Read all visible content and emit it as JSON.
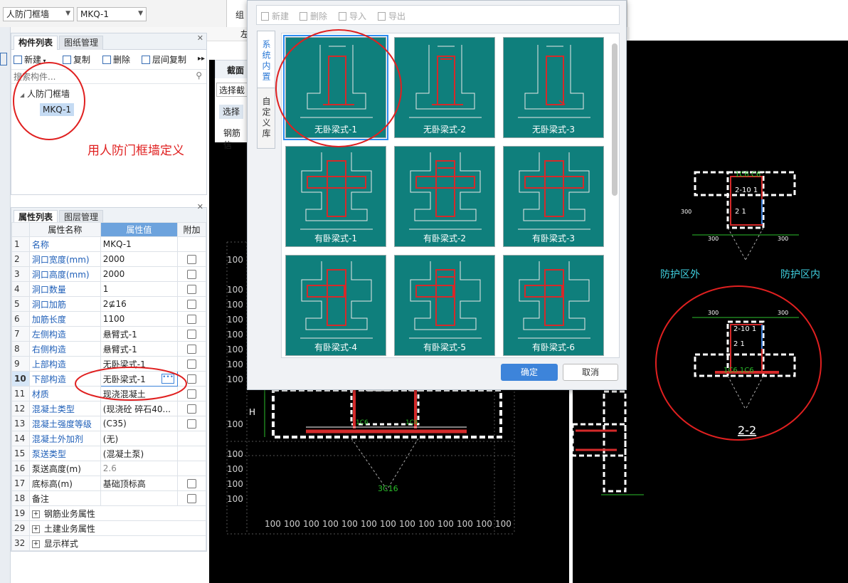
{
  "toolbar": {
    "type_combo": "人防门框墙",
    "item_combo": "MKQ-1",
    "title_fragment": "组",
    "left_fragment": "左"
  },
  "component_panel": {
    "tabs": [
      "构件列表",
      "图纸管理"
    ],
    "buttons": {
      "new": "新建",
      "copy": "复制",
      "delete": "删除",
      "floor_copy": "层间复制"
    },
    "search_placeholder": "搜索构件...",
    "tree_root": "人防门框墙",
    "tree_child": "MKQ-1",
    "annotation": "用人防门框墙定义"
  },
  "property_panel": {
    "tabs": [
      "属性列表",
      "图层管理"
    ],
    "headers": {
      "name": "属性名称",
      "value": "属性值",
      "extra": "附加"
    },
    "rows": [
      {
        "no": "1",
        "name": "名称",
        "value": "MKQ-1",
        "blue": true,
        "check": false
      },
      {
        "no": "2",
        "name": "洞口宽度(mm)",
        "value": "2000",
        "blue": true,
        "check": true
      },
      {
        "no": "3",
        "name": "洞口高度(mm)",
        "value": "2000",
        "blue": true,
        "check": true
      },
      {
        "no": "4",
        "name": "洞口数量",
        "value": "1",
        "blue": true,
        "check": true
      },
      {
        "no": "5",
        "name": "洞口加筋",
        "value": "2⊈16",
        "blue": true,
        "check": true
      },
      {
        "no": "6",
        "name": "加筋长度",
        "value": "1100",
        "blue": true,
        "check": true
      },
      {
        "no": "7",
        "name": "左侧构造",
        "value": "悬臂式-1",
        "blue": true,
        "check": true
      },
      {
        "no": "8",
        "name": "右侧构造",
        "value": "悬臂式-1",
        "blue": true,
        "check": true
      },
      {
        "no": "9",
        "name": "上部构造",
        "value": "无卧梁式-1",
        "blue": true,
        "check": true
      },
      {
        "no": "10",
        "name": "下部构造",
        "value": "无卧梁式-1",
        "blue": true,
        "check": true
      },
      {
        "no": "11",
        "name": "材质",
        "value": "现浇混凝土",
        "blue": true,
        "check": true
      },
      {
        "no": "12",
        "name": "混凝土类型",
        "value": "(现浇砼 碎石40...",
        "blue": true,
        "check": true
      },
      {
        "no": "13",
        "name": "混凝土强度等级",
        "value": "(C35)",
        "blue": true,
        "check": true
      },
      {
        "no": "14",
        "name": "混凝土外加剂",
        "value": "(无)",
        "blue": true,
        "check": false
      },
      {
        "no": "15",
        "name": "泵送类型",
        "value": "(混凝土泵)",
        "blue": true,
        "check": false
      },
      {
        "no": "16",
        "name": "泵送高度(m)",
        "value": "2.6",
        "blue": false,
        "gray": true,
        "check": false
      },
      {
        "no": "17",
        "name": "底标高(m)",
        "value": "基础顶标高",
        "blue": false,
        "check": true
      },
      {
        "no": "18",
        "name": "备注",
        "value": "",
        "blue": false,
        "check": true
      }
    ],
    "groups": [
      {
        "no": "19",
        "name": "钢筋业务属性"
      },
      {
        "no": "29",
        "name": "土建业务属性"
      },
      {
        "no": "32",
        "name": "显示样式"
      }
    ]
  },
  "section_panel": {
    "title": "截面",
    "select_combo": "选择截",
    "select_button": "选择",
    "rebar_label": "钢筋信"
  },
  "dialog": {
    "toolbar": {
      "new": "新建",
      "delete": "删除",
      "import": "导入",
      "export": "导出"
    },
    "side_tabs": [
      "系统内置",
      "自定义库"
    ],
    "tiles": [
      "无卧梁式-1",
      "无卧梁式-2",
      "无卧梁式-3",
      "有卧梁式-1",
      "有卧梁式-2",
      "有卧梁式-3",
      "有卧梁式-4",
      "有卧梁式-5",
      "有卧梁式-6"
    ],
    "ok": "确定",
    "cancel": "取消"
  },
  "cad": {
    "grid_label": "100",
    "h_label": "H",
    "rebar_label": "3C16",
    "protect_outside": "防护区外",
    "protect_inside": "防护区内",
    "section_label": "2-2",
    "dim_300": "300"
  },
  "colors": {
    "tile": "#0f7f7c",
    "accent": "#3d84da",
    "annotation": "#e02020",
    "cad_bg": "#000000"
  }
}
